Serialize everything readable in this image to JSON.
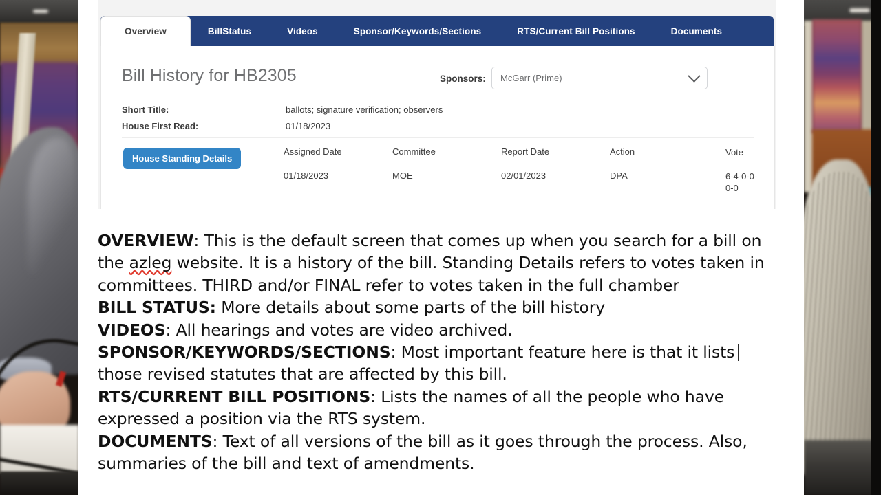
{
  "screenshot_panel": {
    "tabs": [
      {
        "label": "Overview",
        "active": true
      },
      {
        "label": "BillStatus",
        "active": false
      },
      {
        "label": "Videos",
        "active": false
      },
      {
        "label": "Sponsor/Keywords/Sections",
        "active": false
      },
      {
        "label": "RTS/Current Bill Positions",
        "active": false
      },
      {
        "label": "Documents",
        "active": false
      }
    ],
    "bill_title": "Bill History for HB2305",
    "sponsors_label": "Sponsors:",
    "sponsors_selected": "McGarr (Prime)",
    "sponsors_options": [
      "McGarr (Prime)"
    ],
    "meta": [
      {
        "key": "Short Title:",
        "value": "ballots; signature verification; observers"
      },
      {
        "key": "House First Read:",
        "value": "01/18/2023"
      }
    ],
    "standing_button": "House Standing Details",
    "details_table": {
      "headers": [
        "Assigned Date",
        "Committee",
        "Report Date",
        "Action",
        "Vote"
      ],
      "rows": [
        {
          "assigned_date": "01/18/2023",
          "committee": "MOE",
          "report_date": "02/01/2023",
          "action": "DPA",
          "vote": "6-4-0-0-0-0"
        }
      ]
    },
    "colors": {
      "tabbar_navy": "#24417e",
      "active_tab_bg": "#ffffff",
      "standing_button_blue": "#3385c6",
      "panel_bg": "#f3f3f3"
    }
  },
  "notes": {
    "overview": {
      "term": "OVERVIEW",
      "sep": ": ",
      "text_a": "This is the default screen that comes up when you search for a bill on the ",
      "misspelled": "azleg",
      "text_b": " website. It is a history of the bill. Standing Details refers to votes taken in committees. THIRD and/or FINAL refer to votes taken in the full chamber"
    },
    "bill_status": {
      "term": "BILL STATUS:",
      "text": " More details about some parts of the bill history"
    },
    "videos": {
      "term": "VIDEOS",
      "text": ": All hearings and votes are video archived."
    },
    "sponsor_keywords": {
      "term": "SPONSOR/KEYWORDS/SECTIONS",
      "text_a": ": Most important feature here is that it lists",
      "text_b": "those revised statutes that are affected by this bill."
    },
    "rts_positions": {
      "term": "RTS/CURRENT BILL POSITIONS",
      "text": ": Lists the names of all the people who have expressed a position via the RTS system."
    },
    "documents": {
      "term": "DOCUMENTS",
      "text": ": Text of all versions of the bill as it goes through the process. Also, summaries of the bill and text of amendments."
    }
  }
}
